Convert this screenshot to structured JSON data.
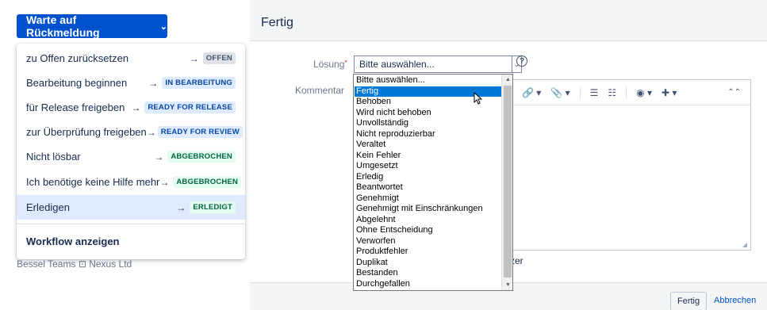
{
  "status_button": {
    "label": "Warte auf Rückmeldung",
    "chevron": "chevron-down-icon"
  },
  "background_text": "Bessel Teams   ⊡   Nexus Ltd",
  "transitions_menu": {
    "items": [
      {
        "label": "zu Offen zurücksetzen",
        "target": "OFFEN",
        "color": "grey"
      },
      {
        "label": "Bearbeitung beginnen",
        "target": "IN BEARBEITUNG",
        "color": "blue"
      },
      {
        "label": "für Release freigeben",
        "target": "READY FOR RELEASE",
        "color": "blue"
      },
      {
        "label": "zur Überprüfung freigeben",
        "target": "READY FOR REVIEW",
        "color": "blue"
      },
      {
        "label": "Nicht lösbar",
        "target": "ABGEBROCHEN",
        "color": "green"
      },
      {
        "label": "Ich benötige keine Hilfe mehr",
        "target": "ABGEBROCHEN",
        "color": "green"
      },
      {
        "label": "Erledigen",
        "target": "ERLEDIGT",
        "color": "green"
      }
    ],
    "arrow": "→",
    "footer": "Workflow anzeigen"
  },
  "dialog": {
    "title": "Fertig",
    "resolution_label": "Lösung",
    "required_mark": "*",
    "select_value": "Bitte auswählen...",
    "comment_label": "Kommentar",
    "user_snip": "utzer",
    "submit_label": "Fertig",
    "cancel_label": "Abbrechen",
    "toolbar": [
      "🔗 ▾",
      "📎 ▾",
      "☰",
      "☷",
      "◉ ▾",
      "✚ ▾"
    ]
  },
  "listbox": {
    "options": [
      "Bitte auswählen...",
      "Fertig",
      "Behoben",
      "Wird nicht behoben",
      "Unvollständig",
      "Nicht reproduzierbar",
      "Veraltet",
      "Kein Fehler",
      "Umgesetzt",
      "Erledig",
      "Beantwortet",
      "Genehmigt",
      "Genehmigt mit Einschränkungen",
      "Abgelehnt",
      "Ohne Entscheidung",
      "Verworfen",
      "Produktfehler",
      "Duplikat",
      "Bestanden",
      "Durchgefallen"
    ],
    "selected": "Fertig"
  },
  "colors": {
    "primary": "#0052cc",
    "selection": "#0078d7",
    "menu_active": "#deebff"
  }
}
